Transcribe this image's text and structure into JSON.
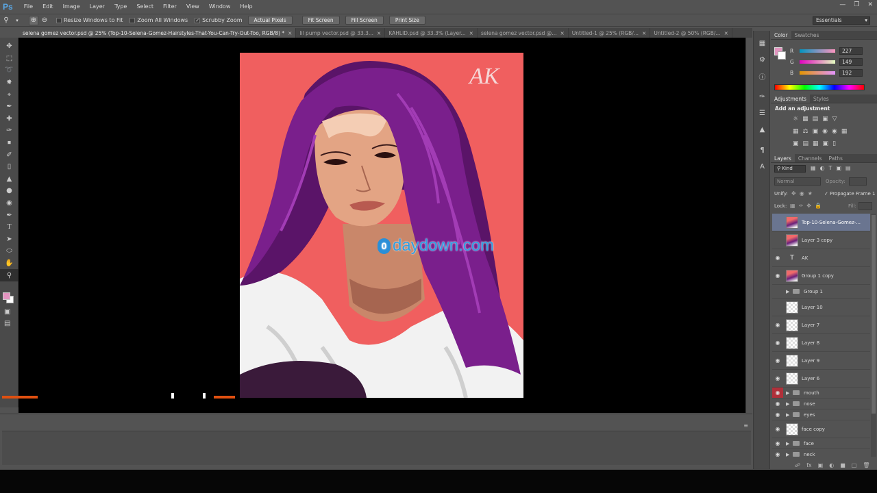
{
  "menubar": {
    "logo": "Ps",
    "items": [
      "File",
      "Edit",
      "Image",
      "Layer",
      "Type",
      "Select",
      "Filter",
      "View",
      "Window",
      "Help"
    ],
    "window_buttons": [
      "minimize",
      "restore",
      "close"
    ]
  },
  "options": {
    "resize_windows": "Resize Windows to Fit",
    "zoom_all": "Zoom All Windows",
    "scrubby_zoom": "Scrubby Zoom",
    "buttons": [
      "Actual Pixels",
      "Fit Screen",
      "Fill Screen",
      "Print Size"
    ],
    "workspace": "Essentials"
  },
  "tabs": [
    {
      "label": "selena gomez vector.psd @ 25% (Top-10-Selena-Gomez-Hairstyles-That-You-Can-Try-Out-Too, RGB/8) *",
      "active": true
    },
    {
      "label": "lil pump vector.psd @ 33.3...",
      "active": false
    },
    {
      "label": "KAHLID.psd @ 33.3% (Layer...",
      "active": false
    },
    {
      "label": "selena gomez vector.psd @...",
      "active": false
    },
    {
      "label": "Untitled-1 @ 25% (RGB/...",
      "active": false
    },
    {
      "label": "Untitled-2 @ 50% (RGB/...",
      "active": false
    }
  ],
  "canvas": {
    "signature": "AK",
    "watermark_o": "0",
    "watermark": "daydown.com"
  },
  "color_panel": {
    "tabs": [
      "Color",
      "Swatches"
    ],
    "r_label": "R",
    "g_label": "G",
    "b_label": "B",
    "r": "227",
    "g": "149",
    "b": "192",
    "foreground": "#e395c0"
  },
  "adjustments": {
    "tabs": [
      "Adjustments",
      "Styles"
    ],
    "title": "Add an adjustment"
  },
  "layers_panel": {
    "tabs": [
      "Layers",
      "Channels",
      "Paths"
    ],
    "kind": "Kind",
    "blend_mode": "Normal",
    "opacity_label": "Opacity:",
    "unify_label": "Unify:",
    "propagate": "Propagate Frame 1",
    "lock_label": "Lock:",
    "fill_label": "Fill:",
    "layers": [
      {
        "name": "Top-10-Selena-Gomez-...",
        "type": "art",
        "visible": false,
        "selected": true
      },
      {
        "name": "Layer 3 copy",
        "type": "art",
        "visible": false
      },
      {
        "name": "AK",
        "type": "text",
        "visible": true
      },
      {
        "name": "Group 1 copy",
        "type": "art",
        "visible": true
      },
      {
        "name": "Group 1",
        "type": "group",
        "visible": false
      },
      {
        "name": "Layer 10",
        "type": "checker",
        "visible": false
      },
      {
        "name": "Layer 7",
        "type": "checker",
        "visible": true
      },
      {
        "name": "Layer 8",
        "type": "checker",
        "visible": true
      },
      {
        "name": "Layer 9",
        "type": "checker",
        "visible": true
      },
      {
        "name": "Layer 6",
        "type": "checker",
        "visible": true
      },
      {
        "name": "mouth",
        "type": "group",
        "visible": true,
        "highlight": true
      },
      {
        "name": "nose",
        "type": "group",
        "visible": true
      },
      {
        "name": "eyes",
        "type": "group",
        "visible": true
      },
      {
        "name": "face  copy",
        "type": "checker",
        "visible": true
      },
      {
        "name": "face",
        "type": "group",
        "visible": true
      },
      {
        "name": "neck",
        "type": "group",
        "visible": true
      }
    ]
  },
  "colors": {
    "accent": "#2f9fe3",
    "canvas_bg": "#f05f5f",
    "hair": "#7a1f8c",
    "selection": "#6a7590"
  }
}
